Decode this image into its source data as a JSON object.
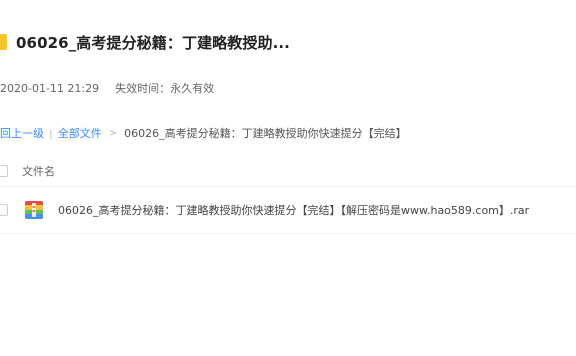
{
  "header": {
    "title": "06026_高考提分秘籍：丁建略教授助...",
    "folder_icon": "folder-icon"
  },
  "meta": {
    "shared_time": "2020-01-11 21:29",
    "expire": "失效时间：永久有效"
  },
  "breadcrumb": {
    "back_label": "回上一级",
    "all_files_label": "全部文件",
    "separator": "|",
    "chevron": ">",
    "current": "06026_高考提分秘籍：丁建略教授助你快速提分【完结】"
  },
  "list": {
    "column_header": "文件名",
    "files": [
      {
        "name": "06026_高考提分秘籍：丁建略教授助你快速提分【完结】【解压密码是www.hao589.com】.rar",
        "icon": "rar-archive-icon"
      }
    ]
  },
  "colors": {
    "accent": "#3b8cff",
    "folder": "#f7c327"
  }
}
